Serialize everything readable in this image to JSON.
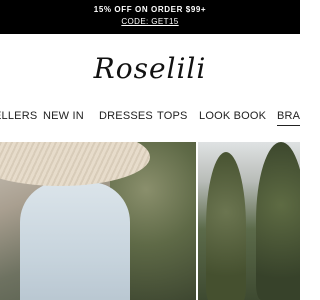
{
  "promo": {
    "headline": "15% OFF ON ORDER $99+",
    "code": "CODE: GET15"
  },
  "brand": {
    "logo_text": "Roselili"
  },
  "nav": {
    "items": [
      {
        "label": "ELLERS"
      },
      {
        "label": "NEW IN"
      },
      {
        "label": "DRESSES"
      },
      {
        "label": "TOPS"
      },
      {
        "label": "LOOK BOOK"
      },
      {
        "label": "BRAN"
      }
    ]
  },
  "colors": {
    "promo_bar_bg": "#000000",
    "promo_text": "#ffffff",
    "nav_text": "#222222"
  }
}
